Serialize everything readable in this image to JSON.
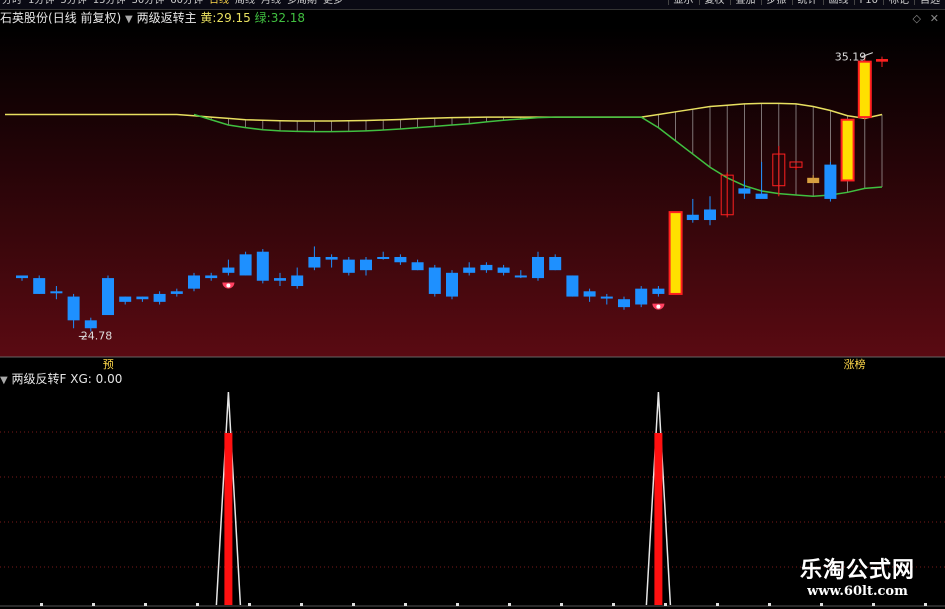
{
  "topbar": {
    "periods": [
      "分时",
      "1分钟",
      "5分钟",
      "15分钟",
      "30分钟",
      "60分钟",
      "日线",
      "周线",
      "月线",
      "多周期",
      "更多"
    ],
    "active_period": "日线",
    "buttons": [
      "显示",
      "复权",
      "叠加",
      "步振",
      "统计",
      "画线",
      "F10",
      "标记",
      "自选"
    ]
  },
  "main_panel": {
    "stock_name": "石英股份",
    "period_mode": "(日线 前复权)",
    "indicator_name": "两级返转主",
    "yellow_label": "黄:",
    "yellow_value": "29.15",
    "green_label": "绿:",
    "green_value": "32.18",
    "high_label": "35.19",
    "low_label": "24.78",
    "bottom_left_tag": "预",
    "bottom_right_tag": "涨榜",
    "colors": {
      "yellow": "#e8e060",
      "green": "#40c040",
      "up": "#ff2020",
      "down": "#1e90ff",
      "signal_fill": "#ffe000"
    }
  },
  "sub_panel": {
    "indicator_name": "两级反转F",
    "xg_label": "XG:",
    "xg_value": "0.00"
  },
  "watermark": {
    "line1": "乐淘公式网",
    "line2": "www.60lt.com"
  },
  "chart_data": {
    "type": "candlestick",
    "ylim": [
      24.0,
      36.2
    ],
    "candles": [
      {
        "o": 26.9,
        "h": 26.9,
        "l": 26.7,
        "c": 26.8,
        "kind": "down"
      },
      {
        "o": 26.8,
        "h": 26.9,
        "l": 26.2,
        "c": 26.2,
        "kind": "down"
      },
      {
        "o": 26.3,
        "h": 26.5,
        "l": 26.0,
        "c": 26.3,
        "kind": "down"
      },
      {
        "o": 26.1,
        "h": 26.2,
        "l": 24.9,
        "c": 25.2,
        "kind": "down"
      },
      {
        "o": 25.2,
        "h": 25.3,
        "l": 24.78,
        "c": 24.9,
        "kind": "down"
      },
      {
        "o": 26.8,
        "h": 26.9,
        "l": 25.4,
        "c": 25.4,
        "kind": "down"
      },
      {
        "o": 26.1,
        "h": 26.1,
        "l": 25.8,
        "c": 25.9,
        "kind": "down"
      },
      {
        "o": 26.1,
        "h": 26.1,
        "l": 25.9,
        "c": 26.0,
        "kind": "down"
      },
      {
        "o": 26.2,
        "h": 26.3,
        "l": 25.8,
        "c": 25.9,
        "kind": "down"
      },
      {
        "o": 26.3,
        "h": 26.4,
        "l": 26.1,
        "c": 26.2,
        "kind": "down"
      },
      {
        "o": 26.9,
        "h": 27.0,
        "l": 26.3,
        "c": 26.4,
        "kind": "down"
      },
      {
        "o": 26.9,
        "h": 27.0,
        "l": 26.7,
        "c": 26.8,
        "kind": "down"
      },
      {
        "o": 27.2,
        "h": 27.5,
        "l": 26.9,
        "c": 27.0,
        "kind": "down"
      },
      {
        "o": 27.7,
        "h": 27.8,
        "l": 26.9,
        "c": 26.9,
        "kind": "down"
      },
      {
        "o": 27.8,
        "h": 27.9,
        "l": 26.6,
        "c": 26.7,
        "kind": "down"
      },
      {
        "o": 26.8,
        "h": 27.0,
        "l": 26.5,
        "c": 26.7,
        "kind": "down"
      },
      {
        "o": 26.9,
        "h": 27.2,
        "l": 26.4,
        "c": 26.5,
        "kind": "down"
      },
      {
        "o": 27.6,
        "h": 28.0,
        "l": 27.1,
        "c": 27.2,
        "kind": "down"
      },
      {
        "o": 27.6,
        "h": 27.7,
        "l": 27.2,
        "c": 27.5,
        "kind": "down"
      },
      {
        "o": 27.5,
        "h": 27.6,
        "l": 26.9,
        "c": 27.0,
        "kind": "down"
      },
      {
        "o": 27.5,
        "h": 27.6,
        "l": 26.9,
        "c": 27.1,
        "kind": "down"
      },
      {
        "o": 27.6,
        "h": 27.8,
        "l": 27.5,
        "c": 27.6,
        "kind": "down"
      },
      {
        "o": 27.6,
        "h": 27.7,
        "l": 27.3,
        "c": 27.4,
        "kind": "down"
      },
      {
        "o": 27.4,
        "h": 27.5,
        "l": 27.1,
        "c": 27.1,
        "kind": "down"
      },
      {
        "o": 27.2,
        "h": 27.3,
        "l": 26.1,
        "c": 26.2,
        "kind": "down"
      },
      {
        "o": 27.0,
        "h": 27.1,
        "l": 26.0,
        "c": 26.1,
        "kind": "down"
      },
      {
        "o": 27.2,
        "h": 27.4,
        "l": 26.9,
        "c": 27.0,
        "kind": "down"
      },
      {
        "o": 27.3,
        "h": 27.4,
        "l": 27.0,
        "c": 27.1,
        "kind": "down"
      },
      {
        "o": 27.2,
        "h": 27.3,
        "l": 26.9,
        "c": 27.0,
        "kind": "down"
      },
      {
        "o": 26.9,
        "h": 27.1,
        "l": 26.8,
        "c": 26.9,
        "kind": "down"
      },
      {
        "o": 27.6,
        "h": 27.8,
        "l": 26.7,
        "c": 26.8,
        "kind": "down"
      },
      {
        "o": 27.6,
        "h": 27.7,
        "l": 27.1,
        "c": 27.1,
        "kind": "down"
      },
      {
        "o": 26.9,
        "h": 26.9,
        "l": 26.1,
        "c": 26.1,
        "kind": "down"
      },
      {
        "o": 26.3,
        "h": 26.4,
        "l": 25.9,
        "c": 26.1,
        "kind": "down"
      },
      {
        "o": 26.1,
        "h": 26.2,
        "l": 25.8,
        "c": 26.1,
        "kind": "down"
      },
      {
        "o": 26.0,
        "h": 26.1,
        "l": 25.6,
        "c": 25.7,
        "kind": "down"
      },
      {
        "o": 26.4,
        "h": 26.5,
        "l": 25.7,
        "c": 25.8,
        "kind": "down"
      },
      {
        "o": 26.4,
        "h": 26.5,
        "l": 26.1,
        "c": 26.2,
        "kind": "down"
      },
      {
        "o": 26.2,
        "h": 29.3,
        "l": 26.2,
        "c": 29.3,
        "kind": "signal"
      },
      {
        "o": 29.2,
        "h": 29.8,
        "l": 28.9,
        "c": 29.0,
        "kind": "down"
      },
      {
        "o": 29.4,
        "h": 29.9,
        "l": 28.8,
        "c": 29.0,
        "kind": "down"
      },
      {
        "o": 29.2,
        "h": 30.8,
        "l": 29.1,
        "c": 30.7,
        "kind": "up"
      },
      {
        "o": 30.2,
        "h": 30.5,
        "l": 29.8,
        "c": 30.0,
        "kind": "down"
      },
      {
        "o": 30.0,
        "h": 31.2,
        "l": 29.9,
        "c": 29.8,
        "kind": "down"
      },
      {
        "o": 30.3,
        "h": 31.8,
        "l": 29.9,
        "c": 31.5,
        "kind": "up"
      },
      {
        "o": 31.0,
        "h": 31.1,
        "l": 30.9,
        "c": 31.2,
        "kind": "up"
      },
      {
        "o": 30.6,
        "h": 30.7,
        "l": 30.5,
        "c": 30.4,
        "kind": "gold"
      },
      {
        "o": 31.1,
        "h": 31.2,
        "l": 29.7,
        "c": 29.8,
        "kind": "down"
      },
      {
        "o": 30.5,
        "h": 32.8,
        "l": 30.5,
        "c": 32.8,
        "kind": "signal"
      },
      {
        "o": 32.9,
        "h": 35.19,
        "l": 32.8,
        "c": 35.0,
        "kind": "signal"
      },
      {
        "o": 35.0,
        "h": 35.19,
        "l": 34.8,
        "c": 35.1,
        "kind": "up"
      }
    ],
    "yellow_line": [
      33.0,
      33.0,
      33.0,
      33.0,
      33.0,
      33.0,
      33.0,
      33.0,
      33.0,
      33.0,
      32.95,
      32.9,
      32.85,
      32.8,
      32.78,
      32.76,
      32.75,
      32.75,
      32.75,
      32.76,
      32.77,
      32.79,
      32.81,
      32.84,
      32.86,
      32.88,
      32.89,
      32.9,
      32.9,
      32.9,
      32.9,
      32.9,
      32.9,
      32.9,
      32.9,
      32.9,
      32.9,
      33.0,
      33.1,
      33.2,
      33.3,
      33.35,
      33.4,
      33.42,
      33.42,
      33.4,
      33.3,
      33.15,
      32.95,
      32.85,
      33.0
    ],
    "green_line": [
      null,
      null,
      null,
      null,
      null,
      null,
      null,
      null,
      null,
      null,
      33.0,
      32.8,
      32.6,
      32.5,
      32.42,
      32.38,
      32.36,
      32.35,
      32.35,
      32.36,
      32.38,
      32.41,
      32.45,
      32.5,
      32.55,
      32.6,
      32.65,
      32.72,
      32.78,
      32.83,
      32.88,
      32.9,
      32.9,
      32.9,
      32.9,
      32.9,
      32.9,
      32.5,
      32.0,
      31.5,
      31.0,
      30.6,
      30.3,
      30.1,
      30.0,
      29.95,
      29.9,
      29.95,
      30.05,
      30.2,
      30.25
    ],
    "signal_markers": [
      12,
      37
    ],
    "xg_spikes": [
      12,
      37
    ]
  }
}
